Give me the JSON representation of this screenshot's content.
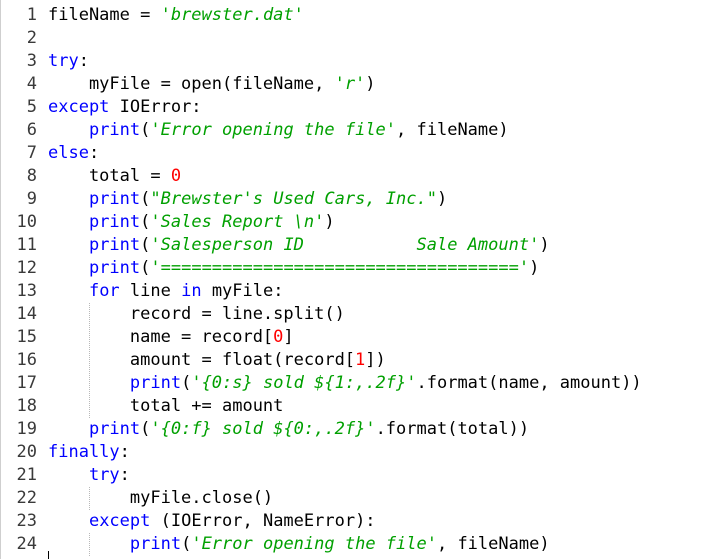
{
  "editor": {
    "lines": [
      {
        "n": "1",
        "tokens": [
          {
            "t": "fileName = ",
            "c": "code"
          },
          {
            "t": "'brewster.dat'",
            "c": "str"
          }
        ]
      },
      {
        "n": "2",
        "tokens": []
      },
      {
        "n": "3",
        "tokens": [
          {
            "t": "try",
            "c": "kw"
          },
          {
            "t": ":",
            "c": "code"
          }
        ]
      },
      {
        "n": "4",
        "tokens": [
          {
            "t": "    myFile = open(fileName, ",
            "c": "code"
          },
          {
            "t": "'r'",
            "c": "str"
          },
          {
            "t": ")",
            "c": "code"
          }
        ]
      },
      {
        "n": "5",
        "tokens": [
          {
            "t": "except",
            "c": "kw"
          },
          {
            "t": " IOError:",
            "c": "code"
          }
        ]
      },
      {
        "n": "6",
        "tokens": [
          {
            "t": "    ",
            "c": "code"
          },
          {
            "t": "print",
            "c": "kw"
          },
          {
            "t": "(",
            "c": "code"
          },
          {
            "t": "'Error opening the file'",
            "c": "str"
          },
          {
            "t": ", fileName)",
            "c": "code"
          }
        ]
      },
      {
        "n": "7",
        "tokens": [
          {
            "t": "else",
            "c": "kw"
          },
          {
            "t": ":",
            "c": "code"
          }
        ]
      },
      {
        "n": "8",
        "tokens": [
          {
            "t": "    total = ",
            "c": "code"
          },
          {
            "t": "0",
            "c": "num"
          }
        ]
      },
      {
        "n": "9",
        "tokens": [
          {
            "t": "    ",
            "c": "code"
          },
          {
            "t": "print",
            "c": "kw"
          },
          {
            "t": "(",
            "c": "code"
          },
          {
            "t": "\"Brewster's Used Cars, Inc.\"",
            "c": "str"
          },
          {
            "t": ")",
            "c": "code"
          }
        ]
      },
      {
        "n": "10",
        "tokens": [
          {
            "t": "    ",
            "c": "code"
          },
          {
            "t": "print",
            "c": "kw"
          },
          {
            "t": "(",
            "c": "code"
          },
          {
            "t": "'Sales Report \\n'",
            "c": "str"
          },
          {
            "t": ")",
            "c": "code"
          }
        ]
      },
      {
        "n": "11",
        "tokens": [
          {
            "t": "    ",
            "c": "code"
          },
          {
            "t": "print",
            "c": "kw"
          },
          {
            "t": "(",
            "c": "code"
          },
          {
            "t": "'Salesperson ID           Sale Amount'",
            "c": "str"
          },
          {
            "t": ")",
            "c": "code"
          }
        ]
      },
      {
        "n": "12",
        "tokens": [
          {
            "t": "    ",
            "c": "code"
          },
          {
            "t": "print",
            "c": "kw"
          },
          {
            "t": "(",
            "c": "code"
          },
          {
            "t": "'==================================='",
            "c": "str"
          },
          {
            "t": ")",
            "c": "code"
          }
        ]
      },
      {
        "n": "13",
        "tokens": [
          {
            "t": "    ",
            "c": "code"
          },
          {
            "t": "for",
            "c": "kw"
          },
          {
            "t": " line ",
            "c": "code"
          },
          {
            "t": "in",
            "c": "kw"
          },
          {
            "t": " myFile:",
            "c": "code"
          }
        ]
      },
      {
        "n": "14",
        "tokens": [
          {
            "t": "        record = line.split()",
            "c": "code"
          }
        ]
      },
      {
        "n": "15",
        "tokens": [
          {
            "t": "        name = record[",
            "c": "code"
          },
          {
            "t": "0",
            "c": "num"
          },
          {
            "t": "]",
            "c": "code"
          }
        ]
      },
      {
        "n": "16",
        "tokens": [
          {
            "t": "        amount = float(record[",
            "c": "code"
          },
          {
            "t": "1",
            "c": "num"
          },
          {
            "t": "])",
            "c": "code"
          }
        ]
      },
      {
        "n": "17",
        "tokens": [
          {
            "t": "        ",
            "c": "code"
          },
          {
            "t": "print",
            "c": "kw"
          },
          {
            "t": "(",
            "c": "code"
          },
          {
            "t": "'{0:s} sold ${1:,.2f}'",
            "c": "str"
          },
          {
            "t": ".format(name, amount))",
            "c": "code"
          }
        ]
      },
      {
        "n": "18",
        "tokens": [
          {
            "t": "        total += amount",
            "c": "code"
          }
        ]
      },
      {
        "n": "19",
        "tokens": [
          {
            "t": "    ",
            "c": "code"
          },
          {
            "t": "print",
            "c": "kw"
          },
          {
            "t": "(",
            "c": "code"
          },
          {
            "t": "'{0:f} sold ${0:,.2f}'",
            "c": "str"
          },
          {
            "t": ".format(total))",
            "c": "code"
          }
        ]
      },
      {
        "n": "20",
        "tokens": [
          {
            "t": "finally",
            "c": "kw"
          },
          {
            "t": ":",
            "c": "code"
          }
        ]
      },
      {
        "n": "21",
        "tokens": [
          {
            "t": "    ",
            "c": "code"
          },
          {
            "t": "try",
            "c": "kw"
          },
          {
            "t": ":",
            "c": "code"
          }
        ]
      },
      {
        "n": "22",
        "tokens": [
          {
            "t": "        myFile.close()",
            "c": "code"
          }
        ]
      },
      {
        "n": "23",
        "tokens": [
          {
            "t": "    ",
            "c": "code"
          },
          {
            "t": "except",
            "c": "kw"
          },
          {
            "t": " (IOError, NameError):",
            "c": "code"
          }
        ]
      },
      {
        "n": "24",
        "tokens": [
          {
            "t": "        ",
            "c": "code"
          },
          {
            "t": "print",
            "c": "kw"
          },
          {
            "t": "(",
            "c": "code"
          },
          {
            "t": "'Error opening the file'",
            "c": "str"
          },
          {
            "t": ", fileName)",
            "c": "code"
          }
        ]
      }
    ]
  },
  "colors": {
    "keyword": "#0000ff",
    "string": "#00a000",
    "number": "#ff0000",
    "text": "#000000",
    "gutter": "#3a3a3a"
  }
}
